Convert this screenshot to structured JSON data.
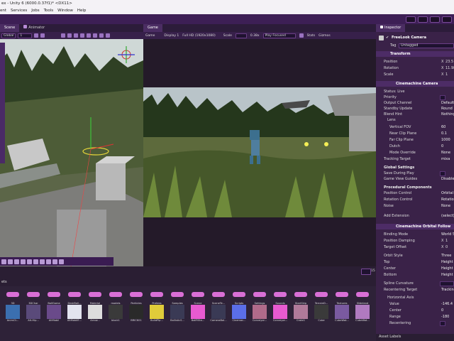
{
  "window": {
    "title": "ex - Unity 6 (6000.0.37f1)* <DX11>"
  },
  "menu": [
    "ent",
    "Services",
    "Jobs",
    "Tools",
    "Window",
    "Help"
  ],
  "tabs": {
    "scene": "Scene",
    "animator": "Animator",
    "game": "Game",
    "inspector": "Inspector"
  },
  "scene_toolbar": {
    "global": "Global",
    "snap": "1"
  },
  "game_toolbar": {
    "display_mode": "Game",
    "display": "Display 1",
    "resolution": "Full HD (1920x1080)",
    "scale_label": "Scale",
    "scale_value": "0.38x",
    "play_focused": "Play Focused",
    "stats": "Stats",
    "gizmos": "Gizmos"
  },
  "status": {
    "count": "15"
  },
  "inspector": {
    "object_name": "FreeLook Camera",
    "tag_label": "Tag",
    "tag_value": "Untagged",
    "transform": {
      "title": "Transform",
      "position_label": "Position",
      "position_axis": "X",
      "position_x": "23.5",
      "rotation_label": "Rotation",
      "rotation_axis": "X",
      "rotation_x": "11.98",
      "scale_label": "Scale",
      "scale_axis": "X",
      "scale_x": "1"
    },
    "cinemachine_camera": {
      "title": "Cinemachine Camera",
      "status_label": "Status: Live",
      "status_value": "",
      "priority_label": "Priority",
      "output_channel_label": "Output Channel",
      "output_channel_value": "Default",
      "standby_label": "Standby Update",
      "standby_value": "Round",
      "blend_hint_label": "Blend Hint",
      "blend_hint_value": "Nothing",
      "lens_label": "Lens",
      "vfov_label": "Vertical FOV",
      "vfov_value": "60",
      "near_label": "Near Clip Plane",
      "near_value": "0.1",
      "far_label": "Far Clip Plane",
      "far_value": "1000",
      "dutch_label": "Dutch",
      "dutch_value": "0",
      "mode_override_label": "Mode Override",
      "mode_override_value": "None",
      "tracking_label": "Tracking Target",
      "tracking_value": "mixa",
      "global_settings": "Global Settings",
      "save_play_label": "Save During Play",
      "game_guides_label": "Game View Guides",
      "game_guides_value": "Disabled",
      "procedural": "Procedural Components",
      "pos_control_label": "Position Control",
      "pos_control_value": "Orbital",
      "rot_control_label": "Rotation Control",
      "rot_control_value": "Rotation",
      "noise_label": "Noise",
      "noise_value": "None",
      "add_ext_label": "Add Extension",
      "add_ext_value": "(select)"
    },
    "orbital_follow": {
      "title": "Cinemachine Orbital Follow",
      "binding_label": "Binding Mode",
      "binding_value": "World S",
      "damping_label": "Position Damping",
      "damping_axis": "X",
      "damping_value": "1",
      "offset_label": "Target Offset",
      "offset_axis": "X",
      "offset_value": "0",
      "orbit_style_label": "Orbit Style",
      "orbit_style_value": "Three",
      "top_label": "Top",
      "top_value": "Height",
      "center_label": "Center",
      "center_value": "Height",
      "bottom_label": "Bottom",
      "bottom_value": "Height",
      "spline_label": "Spline Curvature",
      "recenter_label": "Recentering Target",
      "recenter_value": "Tracking",
      "haxis_label": "Horizontal Axis",
      "value_label": "Value",
      "value_value": "-146.4",
      "center2_label": "Center",
      "center2_value": "0",
      "range_label": "Range",
      "range_value": "-180",
      "recentering_label": "Recentering"
    },
    "asset_labels": "Asset Labels"
  },
  "project": {
    "breadcrumb": "ets",
    "folders": [
      "3D",
      "3DChar",
      "BallGame",
      "DeskBall...",
      "Material",
      "models",
      "Particles",
      "Prefabs",
      "Samples",
      "Scene",
      "SceneTe...",
      "Scripts",
      "Settings",
      "Sounds",
      "StartSkip",
      "TerrainD...",
      "Textures",
      "Slideland"
    ],
    "assets": [
      "AnimCt...",
      "Alt-Hip...",
      "AltMobil",
      "AltMobilE...",
      "Arrow...",
      "block1",
      "BRICK01",
      "BuildPip...",
      "BallisticS...",
      "BallRSta...",
      "CameraBal...",
      "Cinemac...",
      "Conveyor...",
      "Conveyor...",
      "Crate1",
      "Cube",
      "CubeWat...",
      "CubeWat..."
    ]
  }
}
